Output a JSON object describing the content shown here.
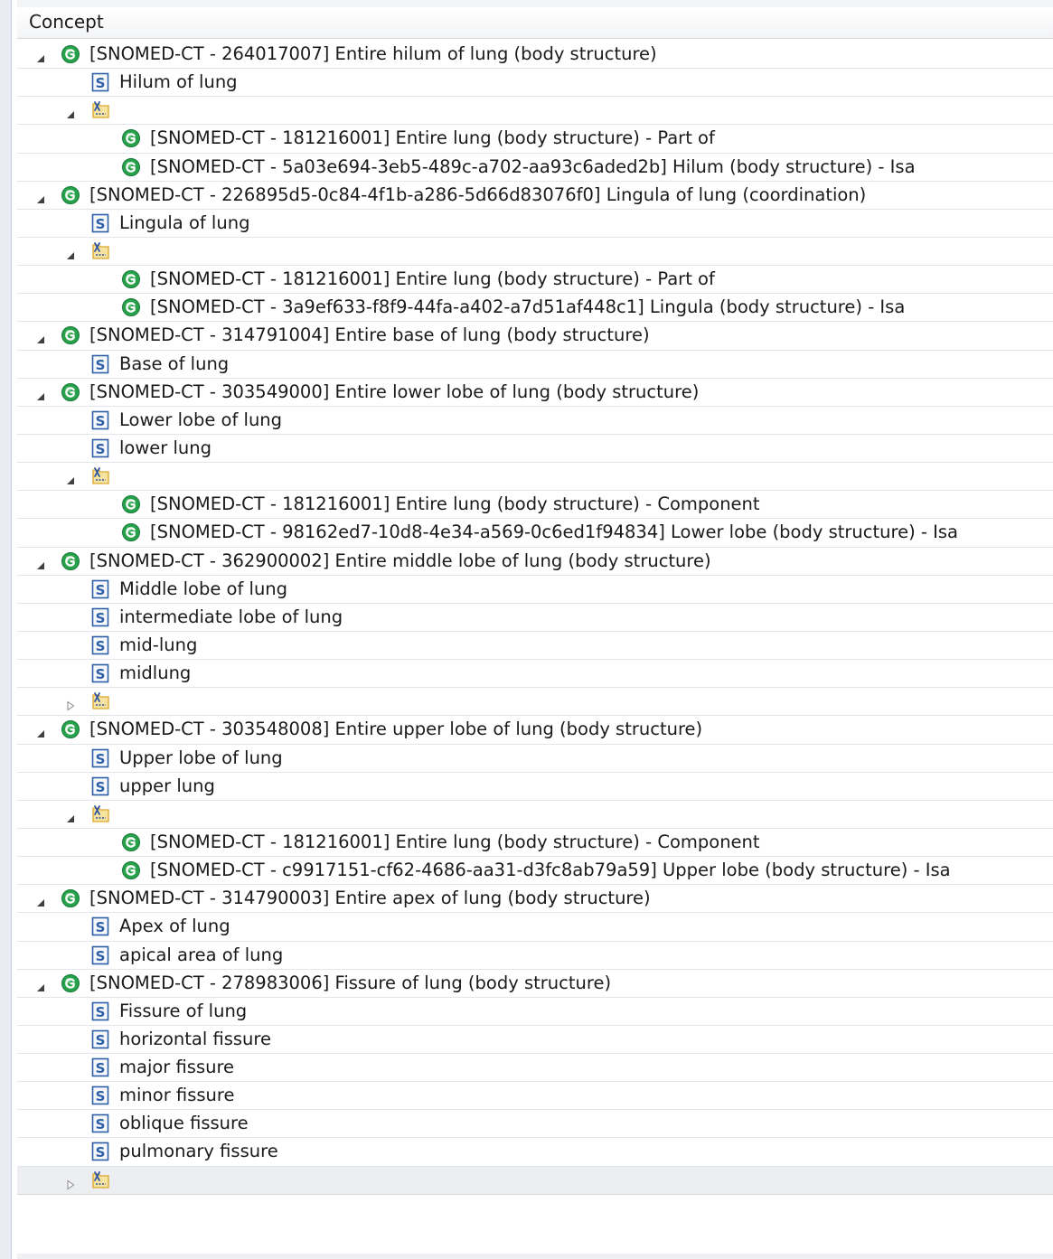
{
  "header": {
    "column_label": "Concept"
  },
  "tree": [
    {
      "depth": 0,
      "twisty": "expanded",
      "icon": "concept-icon",
      "label": "[SNOMED-CT - 264017007] Entire hilum of lung (body structure)"
    },
    {
      "depth": 1,
      "twisty": "none",
      "icon": "synonym-icon",
      "label": "Hilum of lung"
    },
    {
      "depth": 1,
      "twisty": "expanded",
      "icon": "relationship-group-icon",
      "label": ""
    },
    {
      "depth": 2,
      "twisty": "none",
      "icon": "concept-icon",
      "label": "[SNOMED-CT - 181216001] Entire lung (body structure) - Part of"
    },
    {
      "depth": 2,
      "twisty": "none",
      "icon": "concept-icon",
      "label": "[SNOMED-CT - 5a03e694-3eb5-489c-a702-aa93c6aded2b] Hilum (body structure) - Isa"
    },
    {
      "depth": 0,
      "twisty": "expanded",
      "icon": "concept-icon",
      "label": "[SNOMED-CT - 226895d5-0c84-4f1b-a286-5d66d83076f0] Lingula of lung (coordination)"
    },
    {
      "depth": 1,
      "twisty": "none",
      "icon": "synonym-icon",
      "label": "Lingula of lung"
    },
    {
      "depth": 1,
      "twisty": "expanded",
      "icon": "relationship-group-icon",
      "label": ""
    },
    {
      "depth": 2,
      "twisty": "none",
      "icon": "concept-icon",
      "label": "[SNOMED-CT - 181216001] Entire lung (body structure) - Part of"
    },
    {
      "depth": 2,
      "twisty": "none",
      "icon": "concept-icon",
      "label": "[SNOMED-CT - 3a9ef633-f8f9-44fa-a402-a7d51af448c1] Lingula (body structure) - Isa"
    },
    {
      "depth": 0,
      "twisty": "expanded",
      "icon": "concept-icon",
      "label": "[SNOMED-CT - 314791004] Entire base of lung (body structure)"
    },
    {
      "depth": 1,
      "twisty": "none",
      "icon": "synonym-icon",
      "label": "Base of lung"
    },
    {
      "depth": 0,
      "twisty": "expanded",
      "icon": "concept-icon",
      "label": "[SNOMED-CT - 303549000] Entire lower lobe of lung (body structure)"
    },
    {
      "depth": 1,
      "twisty": "none",
      "icon": "synonym-icon",
      "label": "Lower lobe of lung"
    },
    {
      "depth": 1,
      "twisty": "none",
      "icon": "synonym-icon",
      "label": "lower lung"
    },
    {
      "depth": 1,
      "twisty": "expanded",
      "icon": "relationship-group-icon",
      "label": ""
    },
    {
      "depth": 2,
      "twisty": "none",
      "icon": "concept-icon",
      "label": "[SNOMED-CT - 181216001] Entire lung (body structure) - Component"
    },
    {
      "depth": 2,
      "twisty": "none",
      "icon": "concept-icon",
      "label": "[SNOMED-CT - 98162ed7-10d8-4e34-a569-0c6ed1f94834] Lower lobe (body structure) - Isa"
    },
    {
      "depth": 0,
      "twisty": "expanded",
      "icon": "concept-icon",
      "label": "[SNOMED-CT - 362900002] Entire middle lobe of lung (body structure)"
    },
    {
      "depth": 1,
      "twisty": "none",
      "icon": "synonym-icon",
      "label": "Middle lobe of lung"
    },
    {
      "depth": 1,
      "twisty": "none",
      "icon": "synonym-icon",
      "label": "intermediate lobe of lung"
    },
    {
      "depth": 1,
      "twisty": "none",
      "icon": "synonym-icon",
      "label": "mid-lung"
    },
    {
      "depth": 1,
      "twisty": "none",
      "icon": "synonym-icon",
      "label": "midlung"
    },
    {
      "depth": 1,
      "twisty": "collapsed",
      "icon": "relationship-group-icon",
      "label": ""
    },
    {
      "depth": 0,
      "twisty": "expanded",
      "icon": "concept-icon",
      "label": "[SNOMED-CT - 303548008] Entire upper lobe of lung (body structure)"
    },
    {
      "depth": 1,
      "twisty": "none",
      "icon": "synonym-icon",
      "label": "Upper lobe of lung"
    },
    {
      "depth": 1,
      "twisty": "none",
      "icon": "synonym-icon",
      "label": "upper lung"
    },
    {
      "depth": 1,
      "twisty": "expanded",
      "icon": "relationship-group-icon",
      "label": ""
    },
    {
      "depth": 2,
      "twisty": "none",
      "icon": "concept-icon",
      "label": "[SNOMED-CT - 181216001] Entire lung (body structure) - Component"
    },
    {
      "depth": 2,
      "twisty": "none",
      "icon": "concept-icon",
      "label": "[SNOMED-CT - c9917151-cf62-4686-aa31-d3fc8ab79a59] Upper lobe (body structure) - Isa"
    },
    {
      "depth": 0,
      "twisty": "expanded",
      "icon": "concept-icon",
      "label": "[SNOMED-CT - 314790003] Entire apex of lung (body structure)"
    },
    {
      "depth": 1,
      "twisty": "none",
      "icon": "synonym-icon",
      "label": "Apex of lung"
    },
    {
      "depth": 1,
      "twisty": "none",
      "icon": "synonym-icon",
      "label": "apical area of lung"
    },
    {
      "depth": 0,
      "twisty": "expanded",
      "icon": "concept-icon",
      "label": "[SNOMED-CT - 278983006] Fissure of lung (body structure)"
    },
    {
      "depth": 1,
      "twisty": "none",
      "icon": "synonym-icon",
      "label": "Fissure of lung"
    },
    {
      "depth": 1,
      "twisty": "none",
      "icon": "synonym-icon",
      "label": "horizontal fissure"
    },
    {
      "depth": 1,
      "twisty": "none",
      "icon": "synonym-icon",
      "label": "major fissure"
    },
    {
      "depth": 1,
      "twisty": "none",
      "icon": "synonym-icon",
      "label": "minor fissure"
    },
    {
      "depth": 1,
      "twisty": "none",
      "icon": "synonym-icon",
      "label": "oblique fissure"
    },
    {
      "depth": 1,
      "twisty": "none",
      "icon": "synonym-icon",
      "label": "pulmonary fissure"
    },
    {
      "depth": 1,
      "twisty": "collapsed",
      "icon": "relationship-group-icon",
      "label": "",
      "selected": true
    }
  ],
  "colors": {
    "concept_icon": "#27a24a",
    "synonym_icon": "#2d5fa6",
    "relationship_icon": "#d9a72a",
    "twisty": "#404040"
  }
}
